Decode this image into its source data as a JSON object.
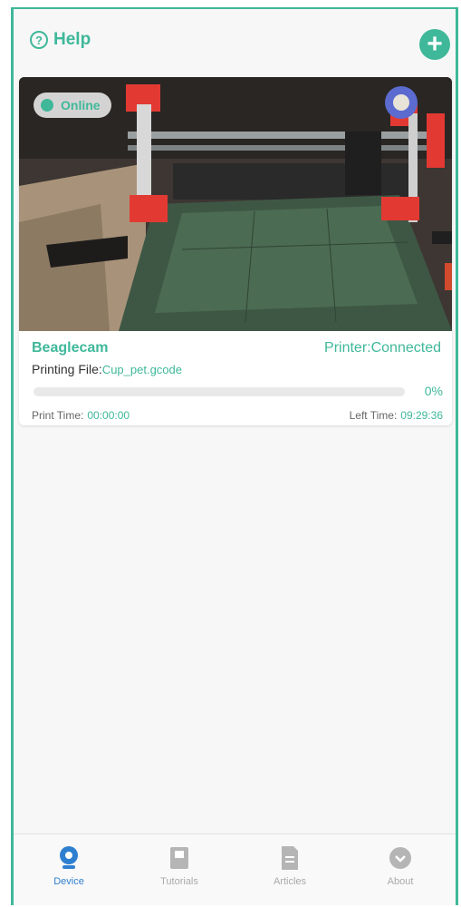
{
  "header": {
    "help_icon": "question-circle-icon",
    "help_label": "Help",
    "add_icon": "plus-icon",
    "add_label": "+"
  },
  "device_card": {
    "status_badge": "Online",
    "device_name": "Beaglecam",
    "printer_status": "Printer:Connected",
    "printing_file_label": "Printing File:",
    "printing_file": "Cup_pet.gcode",
    "progress_percent": 0,
    "progress_text": "0%",
    "print_time_label": "Print Time:",
    "print_time": "00:00:00",
    "left_time_label": "Left Time:",
    "left_time": "09:29:36"
  },
  "tabs": [
    {
      "label": "Device",
      "icon": "camera-icon",
      "active": true
    },
    {
      "label": "Tutorials",
      "icon": "book-icon",
      "active": false
    },
    {
      "label": "Articles",
      "icon": "document-icon",
      "active": false
    },
    {
      "label": "About",
      "icon": "chevron-circle-icon",
      "active": false
    }
  ],
  "colors": {
    "accent": "#3fb89a",
    "active_tab": "#2f7fd0",
    "inactive_tab": "#aaaaaa"
  }
}
